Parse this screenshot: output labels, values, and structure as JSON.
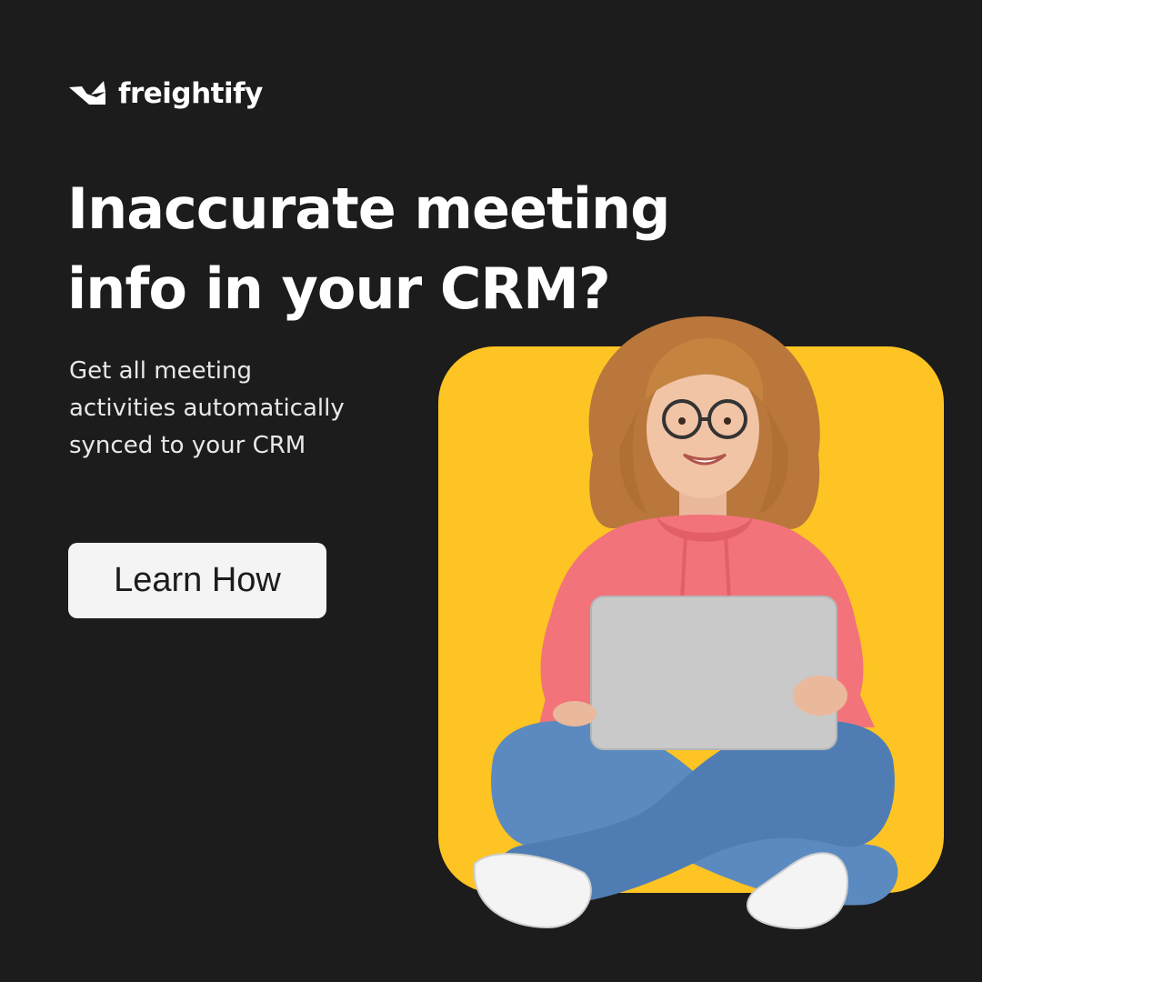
{
  "brand": {
    "name": "freightify",
    "logo_icon": "paper-boat-icon"
  },
  "headline": {
    "line1": "Inaccurate meeting",
    "line2": "info in your CRM?"
  },
  "subtext": {
    "line1": "Get all meeting",
    "line2": "activities automatically",
    "line3": "synced to your CRM"
  },
  "cta": {
    "label": "Learn How"
  },
  "colors": {
    "panel_background": "#1c1c1c",
    "card_accent": "#fec423",
    "button_background": "#f4f4f4",
    "text_primary": "#ffffff"
  }
}
